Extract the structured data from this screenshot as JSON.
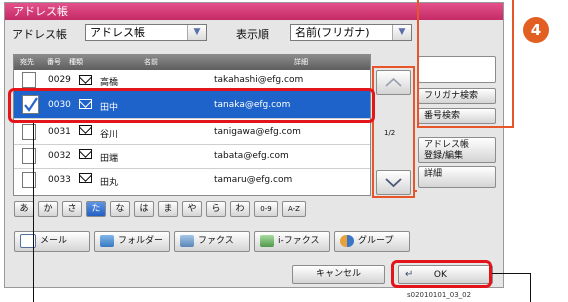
{
  "window": {
    "title": "アドレス帳"
  },
  "toolbar": {
    "address_book_label": "アドレス帳",
    "address_book_value": "アドレス帳",
    "sort_label": "表示順",
    "sort_value": "名前(フリガナ)"
  },
  "table": {
    "headers": [
      "宛先",
      "番号",
      "種類",
      "名前",
      "詳細"
    ],
    "rows": [
      {
        "number": "0029",
        "name": "高橋",
        "email": "takahashi@efg.com",
        "selected": false
      },
      {
        "number": "0030",
        "name": "田中",
        "email": "tanaka@efg.com",
        "selected": true
      },
      {
        "number": "0031",
        "name": "谷川",
        "email": "tanigawa@efg.com",
        "selected": false
      },
      {
        "number": "0032",
        "name": "田端",
        "email": "tabata@efg.com",
        "selected": false
      },
      {
        "number": "0033",
        "name": "田丸",
        "email": "tamaru@efg.com",
        "selected": false
      }
    ]
  },
  "pager": {
    "page": "1/2"
  },
  "side_buttons": {
    "furigana_search": "フリガナ検索",
    "number_search": "番号検索",
    "address_edit_line1": "アドレス帳",
    "address_edit_line2": "登録/編集",
    "detail": "詳細"
  },
  "kana_keys": [
    "あ",
    "か",
    "さ",
    "た",
    "な",
    "は",
    "ま",
    "や",
    "ら",
    "わ",
    "0-9",
    "A-Z"
  ],
  "kana_selected": "た",
  "dest_types": [
    "メール",
    "フォルダー",
    "ファクス",
    "i-ファクス",
    "グループ"
  ],
  "footer": {
    "cancel": "キャンセル",
    "ok": "OK"
  },
  "step_badge": "4",
  "image_code": "s02010101_03_02",
  "colors": {
    "title_bar": "#d23b74",
    "selected_row": "#1d63c9",
    "callout_orange": "#e6562a",
    "highlight_red": "#e3141a"
  }
}
